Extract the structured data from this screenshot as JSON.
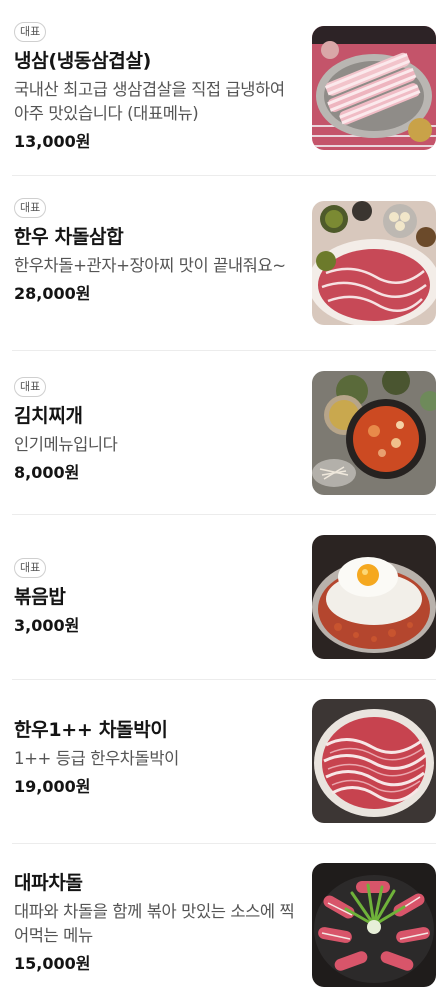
{
  "menu": {
    "items": [
      {
        "badge": "대표",
        "name": "냉삼(냉동삼겹살)",
        "description": "국내산 최고급 생삼겹살을 직접 급냉하여 아주 맛있습니다 (대표메뉴)",
        "price": "13,000원",
        "image": "frozen-pork-belly-photo"
      },
      {
        "badge": "대표",
        "name": "한우 차돌삼합",
        "description": "한우차돌+관자+장아찌 맛이 끝내줘요~",
        "price": "28,000원",
        "image": "beef-brisket-platter-photo"
      },
      {
        "badge": "대표",
        "name": "김치찌개",
        "description": "인기메뉴입니다",
        "price": "8,000원",
        "image": "kimchi-stew-photo"
      },
      {
        "badge": "대표",
        "name": "볶음밥",
        "description": "",
        "price": "3,000원",
        "image": "fried-rice-egg-photo"
      },
      {
        "badge": "",
        "name": "한우1++ 차돌박이",
        "description": "1++ 등급 한우차돌박이",
        "price": "19,000원",
        "image": "beef-brisket-plate-photo"
      },
      {
        "badge": "",
        "name": "대파차돌",
        "description": "대파와 차돌을 함께 볶아 맛있는 소스에 찍어먹는 메뉴",
        "price": "15,000원",
        "image": "green-onion-brisket-photo"
      }
    ]
  }
}
